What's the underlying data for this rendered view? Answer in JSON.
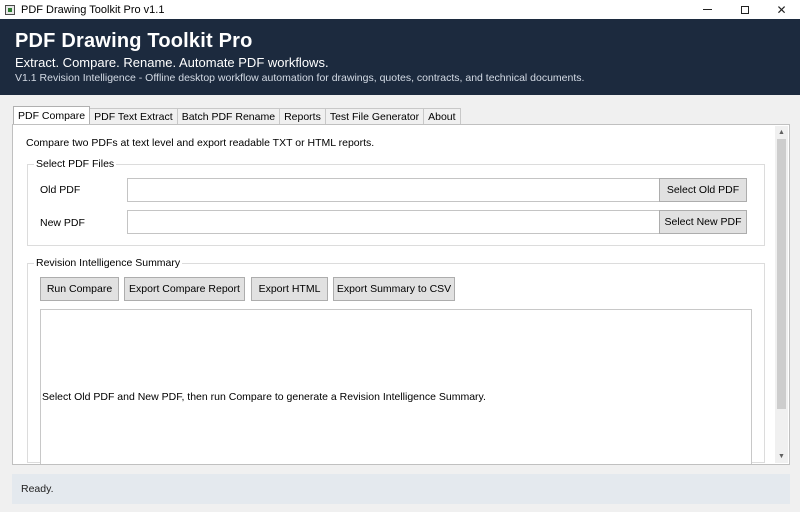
{
  "window": {
    "title": "PDF Drawing Toolkit Pro v1.1",
    "controls": {
      "minimize_icon": "minimize-icon",
      "maximize_icon": "maximize-icon",
      "close_label": "✕"
    }
  },
  "header": {
    "title": "PDF Drawing Toolkit Pro",
    "tagline": "Extract. Compare. Rename. Automate PDF workflows.",
    "subtitle": "V1.1 Revision Intelligence - Offline desktop workflow automation for drawings, quotes, contracts, and technical documents.",
    "background_color": "#1c2a3e"
  },
  "tabs": [
    {
      "label": "PDF Compare",
      "active": true
    },
    {
      "label": "PDF Text Extract",
      "active": false
    },
    {
      "label": "Batch PDF Rename",
      "active": false
    },
    {
      "label": "Reports",
      "active": false
    },
    {
      "label": "Test File Generator",
      "active": false
    },
    {
      "label": "About",
      "active": false
    }
  ],
  "compare": {
    "intro": "Compare two PDFs at text level and export readable TXT or HTML reports.",
    "files_group": {
      "legend": "Select PDF Files",
      "old_pdf_label": "Old PDF",
      "old_pdf_value": "",
      "new_pdf_label": "New PDF",
      "new_pdf_value": "",
      "select_old_label": "Select Old PDF",
      "select_new_label": "Select New PDF"
    },
    "summary_group": {
      "legend": "Revision Intelligence Summary",
      "run_compare_label": "Run Compare",
      "export_report_label": "Export Compare Report",
      "export_html_label": "Export HTML",
      "export_csv_label": "Export Summary to CSV",
      "summary_text": "Select Old PDF and New PDF, then run Compare to generate a Revision Intelligence Summary."
    }
  },
  "status": {
    "text": "Ready."
  }
}
